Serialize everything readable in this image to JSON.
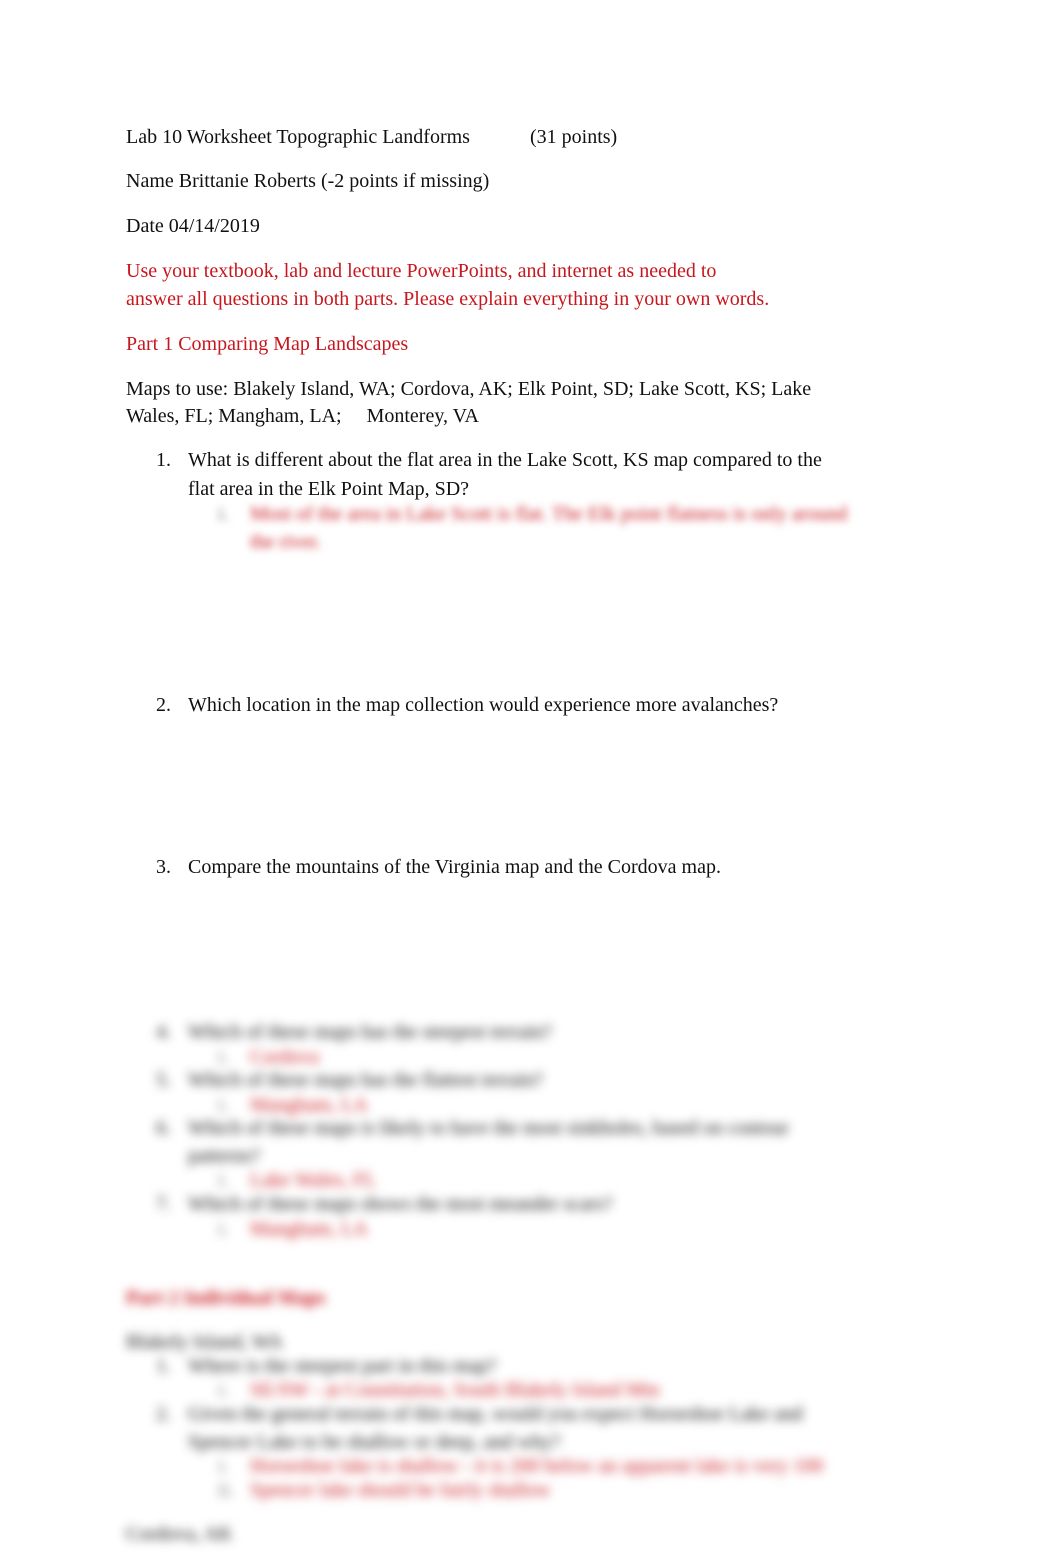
{
  "header": {
    "title": "Lab 10 Worksheet Topographic Landforms",
    "points": "(31 points)",
    "name_line": "Name Brittanie Roberts (-2 points if missing)",
    "date_line": "Date 04/14/2019"
  },
  "instructions": {
    "line1": "Use your textbook, lab and lecture PowerPoints, and internet as needed to",
    "line2": "answer all questions in both parts. Please explain everything in your own words."
  },
  "part1": {
    "heading": "Part 1 Comparing Map Landscapes",
    "maps_line1": "Maps to use: Blakely Island, WA; Cordova, AK; Elk Point, SD; Lake Scott, KS; Lake",
    "maps_line2": "Wales, FL; Mangham, LA;     Monterey, VA",
    "questions": [
      {
        "num": "1.",
        "line1": "What is different about the flat area in the Lake Scott, KS map compared to the",
        "line2": "flat area in the Elk Point Map, SD?",
        "answer_num": "i.",
        "answer_line1": "Most of the area in Lake Scott is flat. The Elk point flatness is only around",
        "answer_line2": "the river."
      },
      {
        "num": "2.",
        "line1": "Which location in the map collection would experience more avalanches?"
      },
      {
        "num": "3.",
        "line1": "Compare the mountains of the Virginia map and the Cordova map."
      },
      {
        "num": "4.",
        "line1": "Which of these maps has the steepest terrain?",
        "answer_num": "i.",
        "answer": "Cordova"
      },
      {
        "num": "5.",
        "line1": "Which of these maps has the flattest terrain?",
        "answer_num": "i.",
        "answer": "Mangham, LA"
      },
      {
        "num": "6.",
        "line1": "Which of these maps is likely to have the most sinkholes, based on contour",
        "line2": "patterns?",
        "answer_num": "i.",
        "answer": "Lake Wales, FL"
      },
      {
        "num": "7.",
        "line1": "Which of these maps shows the most meander scars?",
        "answer_num": "i.",
        "answer": "Mangham, LA"
      }
    ]
  },
  "part2": {
    "heading": "Part 2 Individual Maps",
    "map1": "Blakely Island, WA",
    "questions": [
      {
        "num": "1.",
        "line1": "Where is the steepest part in this map?",
        "answer_num": "i.",
        "answer": "SE/SW - at Constitution, South Blakely Island Mtn"
      },
      {
        "num": "2.",
        "line1": "Given the general terrain of this map, would you expect Horseshoe Lake and",
        "line2": "Spencer Lake to be shallow or deep, and why?",
        "answer_num_a": "i.",
        "answer_a": "Horseshoe lake is shallow - it is 200 below an apparent lake is very 100",
        "answer_num_b": "ii.",
        "answer_b": "Spencer lake should be fairly shallow"
      }
    ],
    "map2": "Cordova, AK"
  }
}
